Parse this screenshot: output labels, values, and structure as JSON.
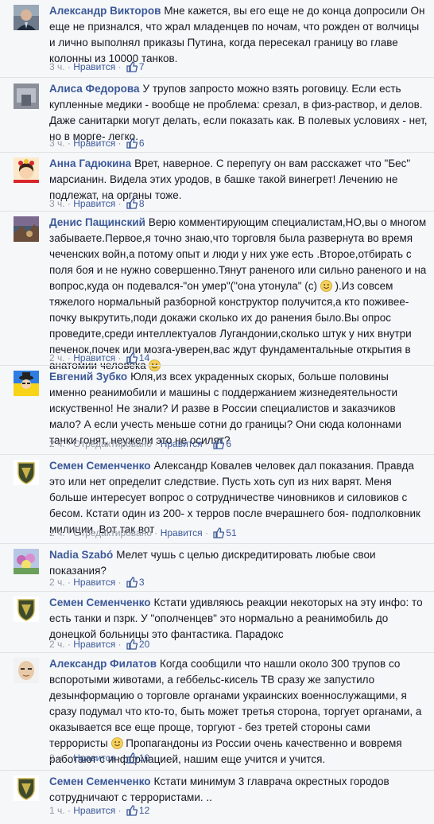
{
  "comments": [
    {
      "author": "Александр Викторов",
      "text": "Мне кажется, вы его еще не до конца допросили Он еще не признался, что жрал младенцев по ночам, что рожден от волчицы и лично выполнял приказы Путина, когда пересекал границу во главе колонны из 10000 танков.",
      "time": "3 ч.",
      "like": "Нравится",
      "likes": "7",
      "avatar_icon": "user-photo-man-suit"
    },
    {
      "author": "Алиса Федорова",
      "text": "У трупов запросто можно взять роговицу. Если есть купленные медики - вообще не проблема: срезал, в физ-раствор, и делов. Даже санитарки могут делать, если показать как. В полевых условиях - нет, но в морге- легко.",
      "time": "3 ч.",
      "like": "Нравится",
      "likes": "6",
      "avatar_icon": "user-photo-interior"
    },
    {
      "author": "Анна Гадюкина",
      "text": "Врет, наверное. С перепугу он вам расскажет что \"Бес\" марсианин. Видела этих уродов, в башке такой винегрет! Лечению не подлежат, на органы тоже.",
      "time": "3 ч.",
      "like": "Нравится",
      "likes": "8",
      "avatar_icon": "user-drawing-woman-wreath"
    },
    {
      "author": "Денис Пащинский",
      "text_parts": [
        "Верю комментирующим специалистам,НО,вы о многом забываете.Первое,я точно знаю,что торговля была развернута во время чеченских войн,а потому опыт и люди у них уже есть .Второе,отбирать с поля боя и не нужно совершенно.Тянут раненого или сильно раненого и на вопрос,куда он подевался-\"он умер\"(\"она утонула\" (с) ",
        " ).Из совсем тяжелого нормальный разборной конструктор получится,а кто поживее-почку выкрутить,поди докажи сколько их до ранения было.Вы опрос проведите,среди интеллектуалов Лугандонии,сколько штук у них внутри печенок,почек или мозга-уверен,вас ждут фундаментальные открытия в анатомии человека "
      ],
      "time": "2 ч.",
      "like": "Нравится",
      "likes": "14",
      "avatar_icon": "user-photo-landscape"
    },
    {
      "author": "Евгений Зубко",
      "text": "Юля,из всех украденных скорых, больше половины именно реанимобили и машины с поддержанием жизнедеятельности искуственно! Не знали? И разве в России специалистов и заказчиков мало? А если учесть меньше сотни до границы? Они сюда колоннами танки гонят, неужели это не осилят?",
      "time": "2 ч.",
      "edited": "Отредактировано",
      "like": "Нравится",
      "likes": "6",
      "avatar_icon": "user-drawing-hat-flag"
    },
    {
      "author": "Семен Семенченко",
      "text": "Александр Ковалев человек дал показания. Правда это или нет определит следствие. Пусть хоть суп из них варят. Меня больше интересует вопрос о сотрудничестве чиновников и силовиков с бесом. Кстати один из 200- х терров после вчерашнего боя- подполковник милиции. Вот так вот",
      "time": "2 ч.",
      "edited": "Отредактировано",
      "like": "Нравится",
      "likes": "51",
      "avatar_icon": "battalion-shield-icon"
    },
    {
      "author": "Nadia Szabó",
      "text": "Мелет чушь с целью дискредитировать любые свои показания?",
      "time": "2 ч.",
      "like": "Нравится",
      "likes": "3",
      "avatar_icon": "user-photo-flowers"
    },
    {
      "author": "Семен Семенченко",
      "text": "Кстати удивляюсь реакции некоторых на эту инфо: то есть танки и пзрк. У \"ополченцев\" это нормально а реанимобиль до донецкой больницы это фантастика. Парадокс",
      "time": "2 ч.",
      "like": "Нравится",
      "likes": "20",
      "avatar_icon": "battalion-shield-icon"
    },
    {
      "author": "Александр Филатов",
      "text_parts": [
        "Когда сообщили что нашли около 300 трупов со вспоротыми животами, а геббельс-кисель ТВ сразу же запустило дезынформацию о торговле органами украинских военнослужащими, я сразу подумал что кто-то, быть может третья сторона, торгует органами, а оказывается все еще проще, торгуют - без третей стороны сами террористы ",
        " Пропагандоны из России очень качественно и вовремя работают с информацией, нашим еще учится и учится."
      ],
      "time": "2 ч.",
      "like": "Нравится",
      "likes": "10",
      "avatar_icon": "user-drawing-bald-man"
    },
    {
      "author": "Семен Семенченко",
      "text": "Кстати минимум 3 главрача окрестных городов сотрудничают с террористами. ..",
      "time": "1 ч.",
      "like": "Нравится",
      "likes": "12",
      "avatar_icon": "battalion-shield-icon"
    }
  ],
  "colors": {
    "link": "#3b5998",
    "meta": "#9197a3",
    "text": "#141823",
    "background": "#f6f7f9"
  }
}
